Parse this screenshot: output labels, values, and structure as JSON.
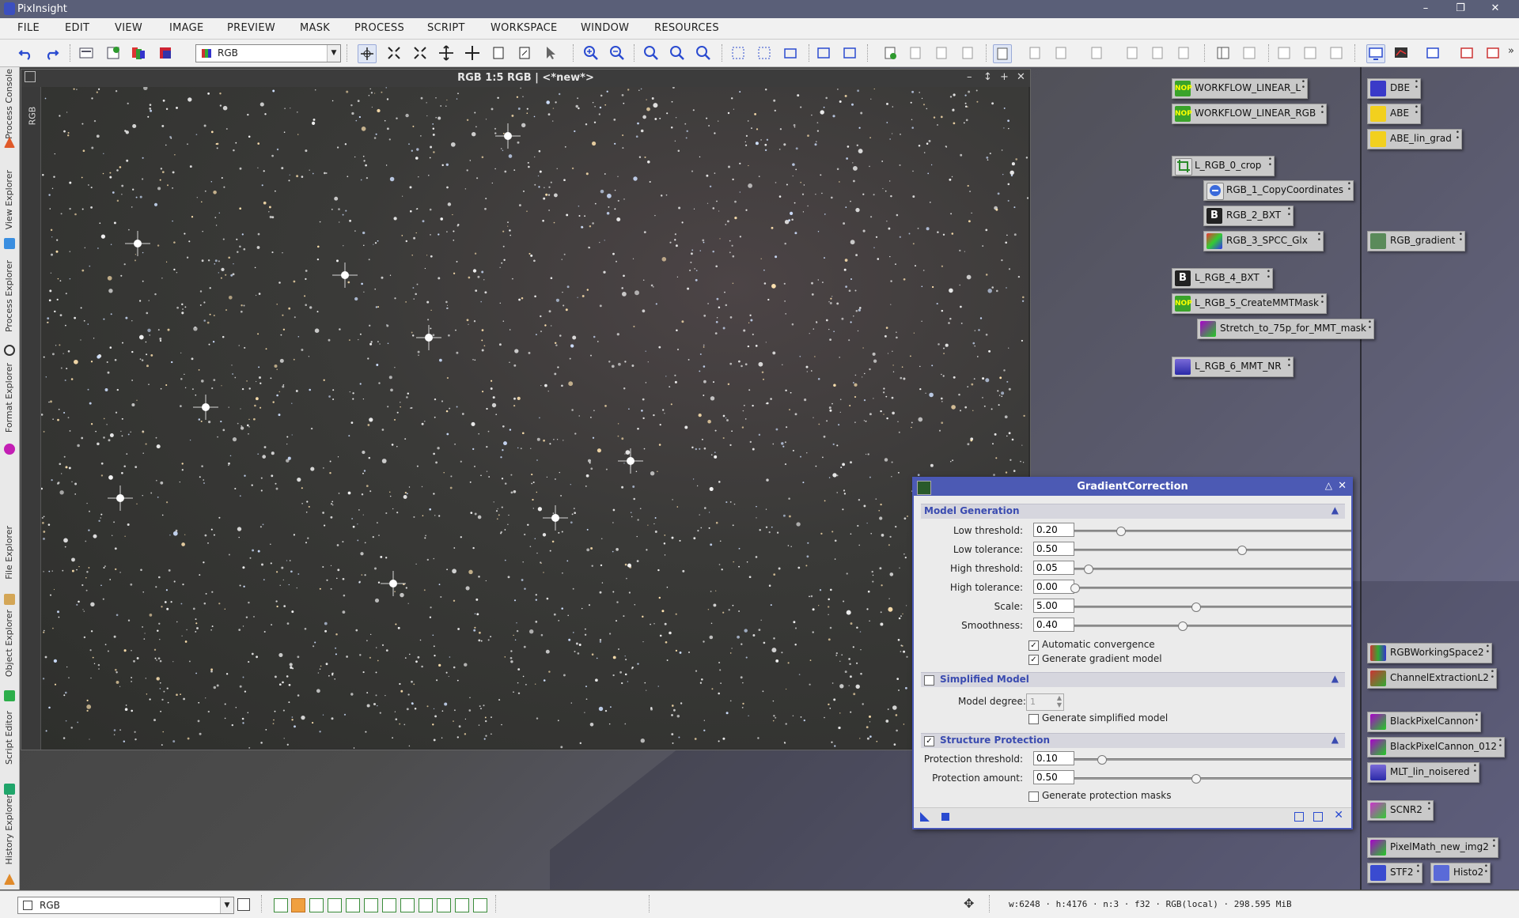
{
  "app": {
    "title": "PixInsight"
  },
  "menu": [
    "FILE",
    "EDIT",
    "VIEW",
    "IMAGE",
    "PREVIEW",
    "MASK",
    "PROCESS",
    "SCRIPT",
    "WORKSPACE",
    "WINDOW",
    "RESOURCES"
  ],
  "toolbar": {
    "view_select": "RGB"
  },
  "left_tabs": [
    "Process Console",
    "View Explorer",
    "Process Explorer",
    "Format Explorer",
    "File Explorer",
    "Object Explorer",
    "Script Editor",
    "History Explorer"
  ],
  "image_window": {
    "title": "RGB 1:5 RGB | <*new*>",
    "side_label": "RGB"
  },
  "process_icons_left": [
    {
      "label": "WORKFLOW_LINEAR_L",
      "badge": "NOP"
    },
    {
      "label": "WORKFLOW_LINEAR_RGB",
      "badge": "NOP"
    },
    {
      "label": "L_RGB_0_crop",
      "badge": ""
    },
    {
      "label": "RGB_1_CopyCoordinates",
      "badge": ""
    },
    {
      "label": "RGB_2_BXT",
      "badge": "B"
    },
    {
      "label": "RGB_3_SPCC_Glx",
      "badge": ""
    },
    {
      "label": "L_RGB_4_BXT",
      "badge": "B"
    },
    {
      "label": "L_RGB_5_CreateMMTMask",
      "badge": "NOP"
    },
    {
      "label": "Stretch_to_75p_for_MMT_mask",
      "badge": ""
    },
    {
      "label": "L_RGB_6_MMT_NR",
      "badge": ""
    }
  ],
  "process_icons_right": [
    {
      "label": "DBE"
    },
    {
      "label": "ABE"
    },
    {
      "label": "ABE_lin_grad"
    },
    {
      "label": "RGB_gradient"
    },
    {
      "label": "RGBWorkingSpace2"
    },
    {
      "label": "ChannelExtractionL2"
    },
    {
      "label": "BlackPixelCannon"
    },
    {
      "label": "BlackPixelCannon_012"
    },
    {
      "label": "MLT_lin_noisered"
    },
    {
      "label": "SCNR2"
    },
    {
      "label": "PixelMath_new_img2"
    },
    {
      "label": "STF2"
    },
    {
      "label": "Histo2"
    }
  ],
  "dialog": {
    "title": "GradientCorrection",
    "model_generation": {
      "title": "Model Generation",
      "params": [
        {
          "label": "Low threshold:",
          "value": "0.20",
          "fraction": 0.17
        },
        {
          "label": "Low tolerance:",
          "value": "0.50",
          "fraction": 0.62
        },
        {
          "label": "High threshold:",
          "value": "0.05",
          "fraction": 0.05
        },
        {
          "label": "High tolerance:",
          "value": "0.00",
          "fraction": 0.0
        },
        {
          "label": "Scale:",
          "value": "5.00",
          "fraction": 0.45
        },
        {
          "label": "Smoothness:",
          "value": "0.40",
          "fraction": 0.4
        }
      ],
      "auto_convergence": {
        "label": "Automatic convergence",
        "checked": true
      },
      "gen_gradient_model": {
        "label": "Generate gradient model",
        "checked": true
      }
    },
    "simplified_model": {
      "title": "Simplified Model",
      "checked": false,
      "degree_label": "Model degree:",
      "degree_value": "1",
      "gen_simplified": {
        "label": "Generate simplified model",
        "checked": false
      }
    },
    "structure_protection": {
      "title": "Structure Protection",
      "checked": true,
      "params": [
        {
          "label": "Protection threshold:",
          "value": "0.10",
          "fraction": 0.1
        },
        {
          "label": "Protection amount:",
          "value": "0.50",
          "fraction": 0.45
        }
      ],
      "gen_masks": {
        "label": "Generate protection masks",
        "checked": false
      }
    }
  },
  "status": {
    "view_select": "RGB",
    "info": "w:6248 · h:4176 · n:3 · f32 · RGB(local) · 298.595 MiB"
  }
}
